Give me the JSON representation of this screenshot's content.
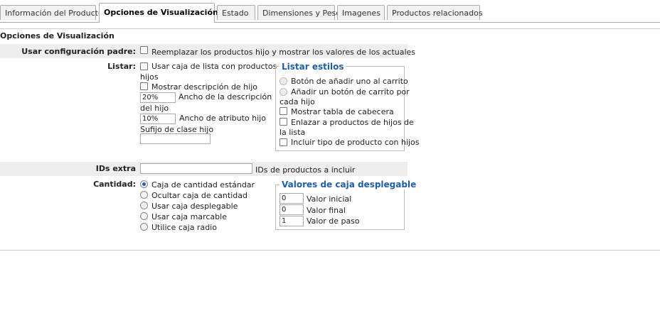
{
  "tabs": [
    {
      "label": "Información del Producto",
      "active": false
    },
    {
      "label": "Opciones de Visualización",
      "active": true
    },
    {
      "label": "Estado",
      "active": false
    },
    {
      "label": "Dimensiones y Peso",
      "active": false
    },
    {
      "label": "Imagenes",
      "active": false
    },
    {
      "label": "Productos relacionados",
      "active": false
    }
  ],
  "section_title": "Opciones de Visualización",
  "parent_config": {
    "label": "Usar configuración padre:",
    "checkbox_label": "Reemplazar los productos hijo y mostrar los valores de los actuales"
  },
  "list": {
    "label": "Listar:",
    "use_listbox_line1": "Usar caja de lista con productos",
    "use_listbox_line2": "hijos",
    "show_desc": "Mostrar descripción de hijo",
    "desc_width_value": "20%",
    "desc_width_label_line1": "Ancho de la descripción",
    "desc_width_label_line2": "del hijo",
    "attr_width_value": "10%",
    "attr_width_label": "Ancho de atributo hijo",
    "class_suffix_label": "Sufijo de clase hijo",
    "class_suffix_value": ""
  },
  "list_styles": {
    "legend": "Listar estilos",
    "opt1": "Botón de añadir uno al carrito",
    "opt2_line1": "Añadir un botón de carrito por",
    "opt2_line2": "cada hijo",
    "opt3": "Mostrar tabla de cabecera",
    "opt4_line1": "Enlazar a productos de hijos de",
    "opt4_line2": "la lista",
    "opt5": "Incluir tipo de producto con hijos"
  },
  "extra_ids": {
    "label": "IDs extra",
    "value": "",
    "hint": "IDs de productos a incluir"
  },
  "quantity": {
    "label": "Cantidad:",
    "options": [
      "Caja de cantidad estándar",
      "Ocultar caja de cantidad",
      "Usar caja desplegable",
      "Usar caja marcable",
      "Utilice caja radio"
    ]
  },
  "dropdown_values": {
    "legend": "Valores de caja desplegable",
    "initial_value": "0",
    "initial_label": "Valor inicial",
    "final_value": "0",
    "final_label": "Valor final",
    "step_value": "1",
    "step_label": "Valor de paso"
  },
  "colors": {
    "legend": "#1f5fa9",
    "row_bg": "#eeeeee",
    "radio_on": "#2d5fa8"
  }
}
